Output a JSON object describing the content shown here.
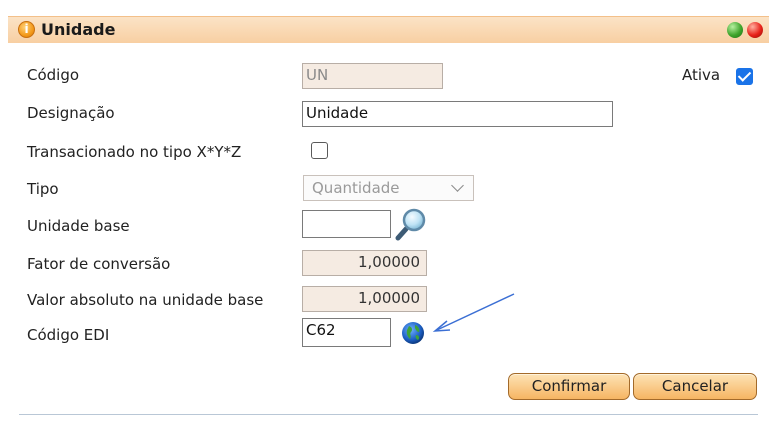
{
  "title": "Unidade",
  "fields": {
    "codigo": {
      "label": "Código",
      "value": "UN"
    },
    "ativa": {
      "label": "Ativa",
      "checked": true
    },
    "designacao": {
      "label": "Designação",
      "value": "Unidade"
    },
    "transacionado": {
      "label": "Transacionado no tipo X*Y*Z",
      "checked": false
    },
    "tipo": {
      "label": "Tipo",
      "value": "Quantidade"
    },
    "unidade_base": {
      "label": "Unidade base",
      "value": ""
    },
    "fator": {
      "label": "Fator de conversão",
      "value": "1,00000"
    },
    "valor_absoluto": {
      "label": "Valor absoluto na unidade base",
      "value": "1,00000"
    },
    "codigo_edi": {
      "label": "Código EDI",
      "value": "C62"
    }
  },
  "buttons": {
    "confirm": "Confirmar",
    "cancel": "Cancelar"
  },
  "icons": {
    "title": "info-icon",
    "window_green": "green-circle-icon",
    "window_red": "red-circle-icon",
    "search": "magnifier-icon",
    "globe": "globe-icon",
    "annotation": "blue-arrow"
  },
  "colors": {
    "titlebar": "#f8cfa2",
    "button": "#f6b563",
    "checkbox_checked": "#1a73e8",
    "annotation_arrow": "#3b6fd4"
  }
}
